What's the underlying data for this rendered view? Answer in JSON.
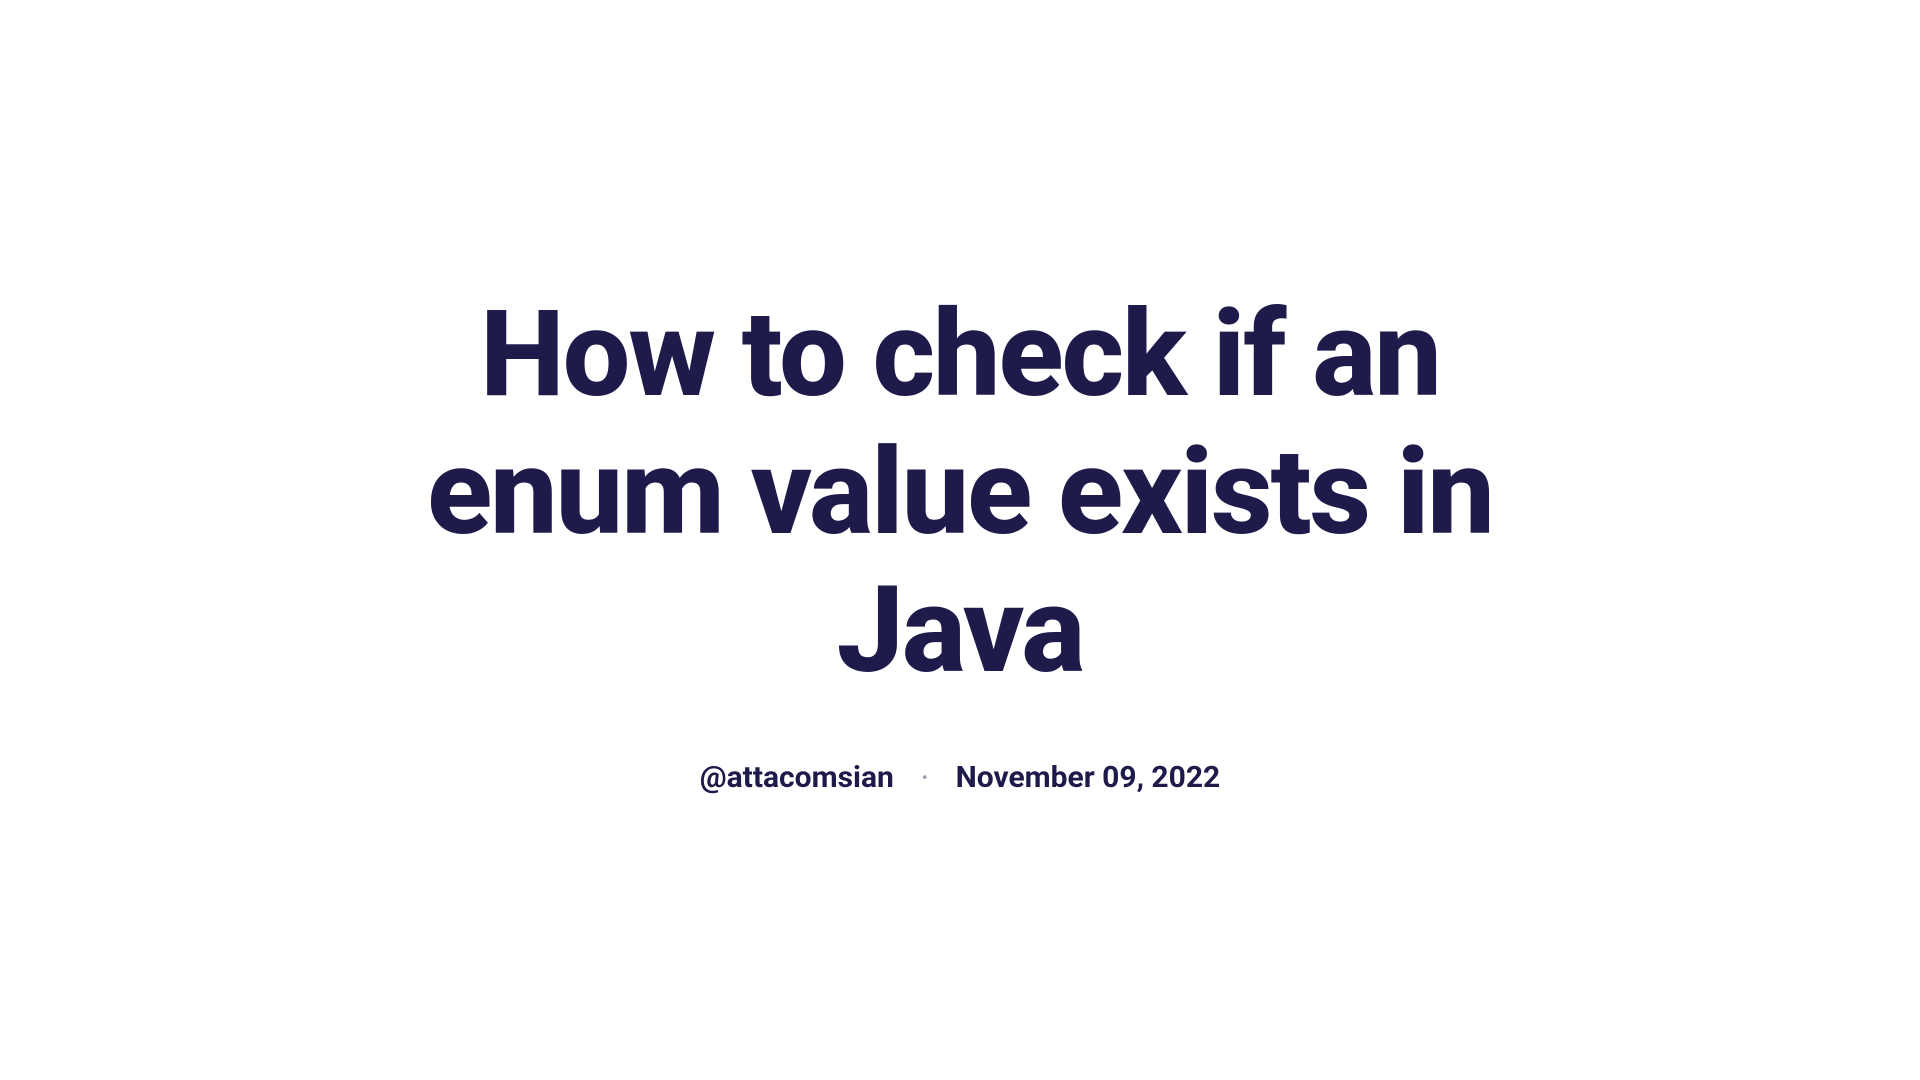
{
  "article": {
    "title": "How to check if an enum value exists in Java",
    "author": "@attacomsian",
    "date": "November 09, 2022",
    "separator": "•"
  }
}
